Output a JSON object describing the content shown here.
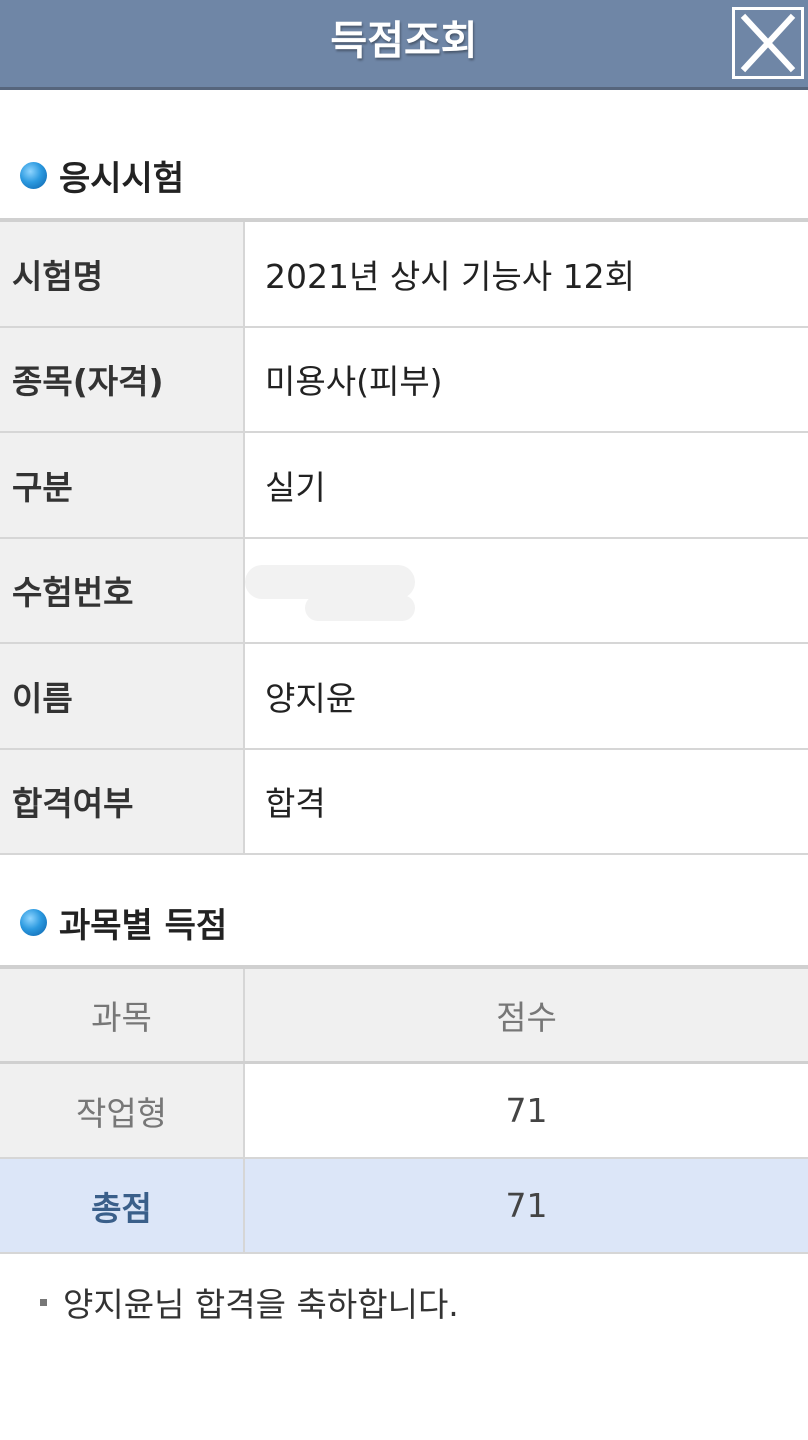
{
  "header": {
    "title": "득점조회",
    "close_icon": "close-icon"
  },
  "exam_section": {
    "title": "응시시험",
    "rows": [
      {
        "label": "시험명",
        "value": "2021년 상시 기능사 12회"
      },
      {
        "label": "종목(자격)",
        "value": "미용사(피부)"
      },
      {
        "label": "구분",
        "value": "실기"
      },
      {
        "label": "수험번호",
        "value": ""
      },
      {
        "label": "이름",
        "value": "양지윤"
      },
      {
        "label": "합격여부",
        "value": "합격"
      }
    ]
  },
  "score_section": {
    "title": "과목별 득점",
    "header": {
      "subject": "과목",
      "score": "점수"
    },
    "rows": [
      {
        "subject": "작업형",
        "score": "71"
      }
    ],
    "total": {
      "subject": "총점",
      "score": "71"
    }
  },
  "note": "양지윤님 합격을 축하합니다.",
  "colors": {
    "header_bg": "#6f86a6",
    "total_row_bg": "#dce6f8",
    "total_label": "#3a5f8a"
  }
}
